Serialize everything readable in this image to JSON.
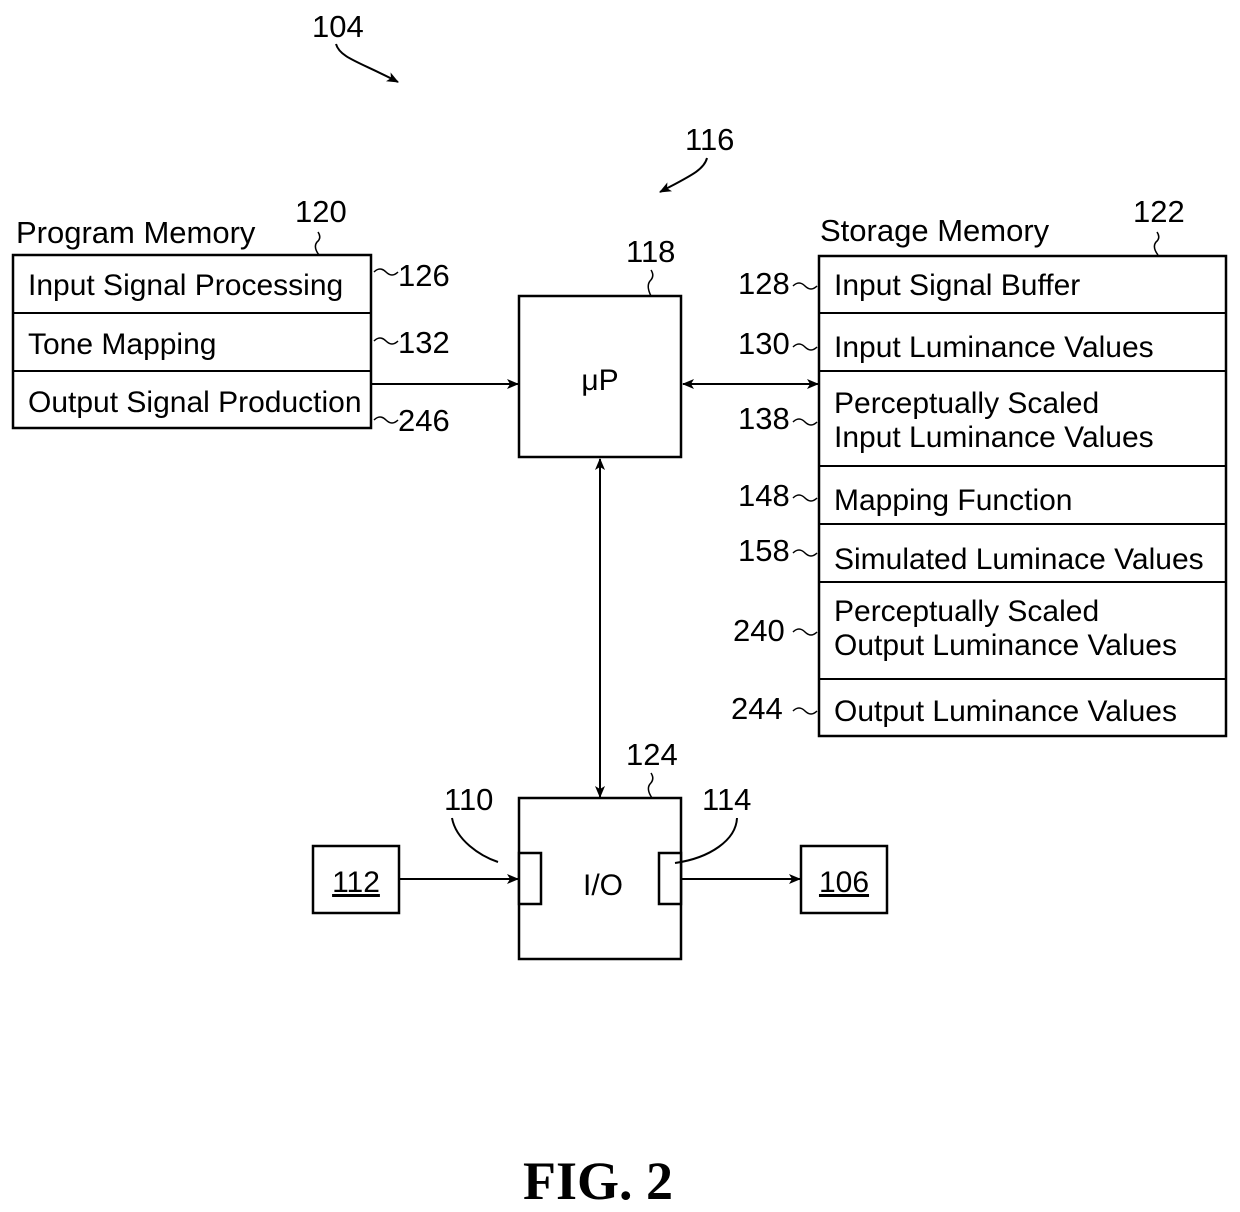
{
  "figure": {
    "caption": "FIG. 2",
    "system_ref": "104",
    "processor_group_ref": "116"
  },
  "program_memory": {
    "title": "Program Memory",
    "ref": "120",
    "items": [
      {
        "label": "Input Signal Processing",
        "ref": "126"
      },
      {
        "label": "Tone Mapping",
        "ref": "132"
      },
      {
        "label": "Output Signal Production",
        "ref": "246"
      }
    ]
  },
  "storage_memory": {
    "title": "Storage Memory",
    "ref": "122",
    "items": [
      {
        "lines": [
          "Input Signal Buffer"
        ],
        "ref": "128"
      },
      {
        "lines": [
          "Input Luminance Values"
        ],
        "ref": "130"
      },
      {
        "lines": [
          "Perceptually Scaled",
          "Input Luminance Values"
        ],
        "ref": "138"
      },
      {
        "lines": [
          "Mapping Function"
        ],
        "ref": "148"
      },
      {
        "lines": [
          "Simulated Luminace Values"
        ],
        "ref": "158"
      },
      {
        "lines": [
          "Perceptually Scaled",
          "Output Luminance Values"
        ],
        "ref": "240"
      },
      {
        "lines": [
          "Output Luminance Values"
        ],
        "ref": "244"
      }
    ]
  },
  "processor": {
    "label": "μP",
    "ref": "118"
  },
  "io": {
    "label": "I/O",
    "ref": "124",
    "input_port_ref": "110",
    "output_port_ref": "114"
  },
  "input_device": {
    "label": "112"
  },
  "output_device": {
    "label": "106"
  }
}
